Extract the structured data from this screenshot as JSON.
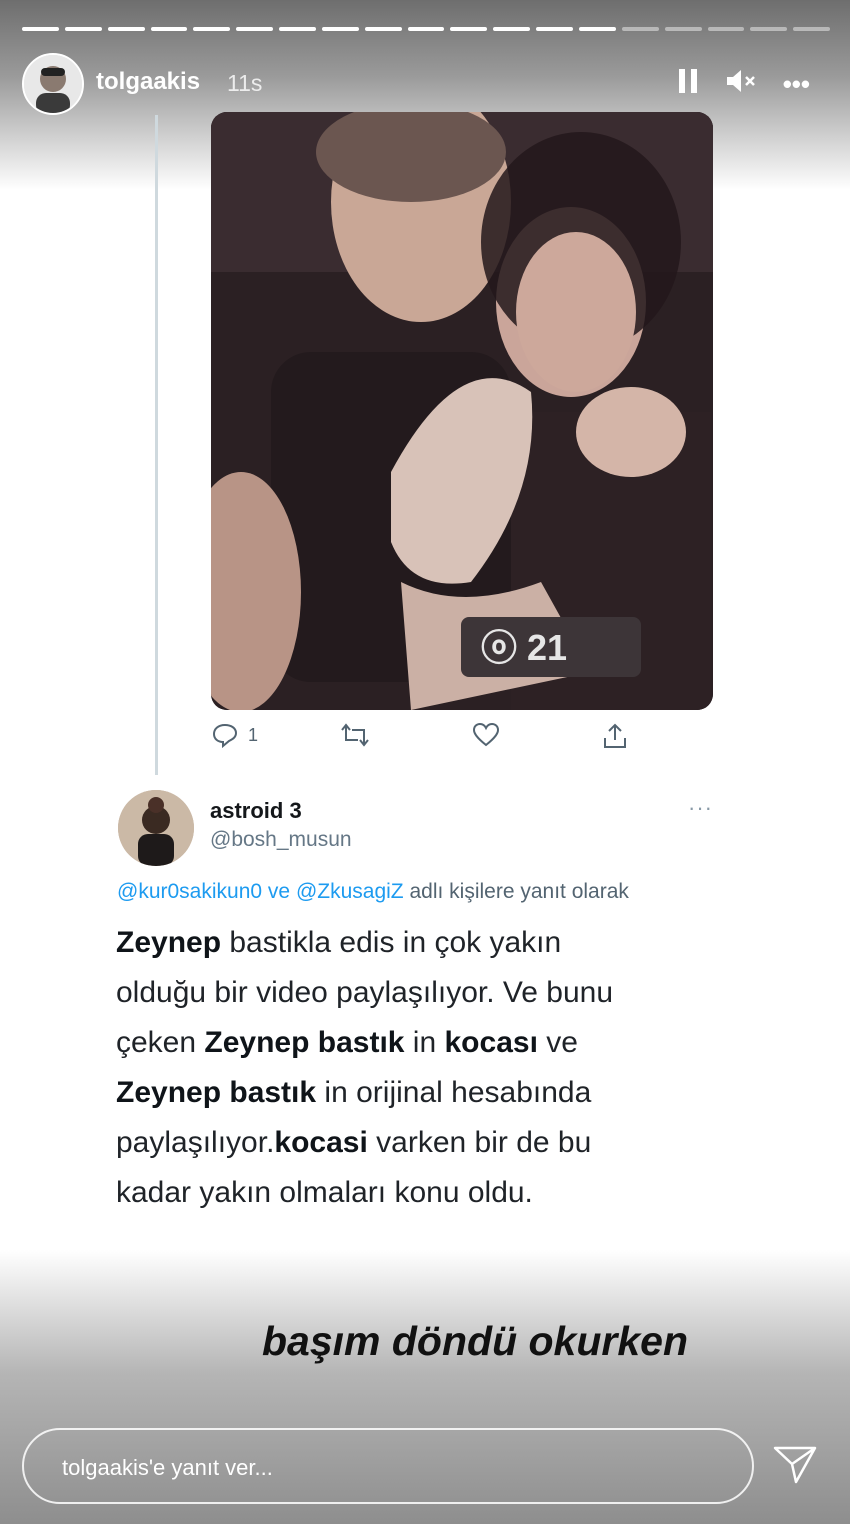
{
  "story": {
    "username": "tolgaakis",
    "time": "11s",
    "progress": {
      "segments": 19,
      "completed": 14
    }
  },
  "header_icons": {
    "pause": "pause-icon",
    "mute": "speaker-muted-icon",
    "more": "•••"
  },
  "tweet_actions": {
    "reply_count": "1"
  },
  "reply_tweet": {
    "name": "astroid 3",
    "handle": "@bosh_musun",
    "more": "···",
    "mention_1": "@kur0sakikun0",
    "mention_joiner": "ve",
    "mention_2": "@ZkusagiZ",
    "mention_suffix": "adlı kişilere yanıt olarak",
    "text": {
      "l1_b": "Zeynep",
      "l1_r": " bastikla edis in çok yakın",
      "l2": "olduğu bir video paylaşılıyor. Ve bunu",
      "l3_a": "çeken ",
      "l3_b1": "Zeynep bastık",
      "l3_m": " in ",
      "l3_b2": "kocası",
      "l3_e": " ve",
      "l4_b": "Zeynep bastık",
      "l4_r": " in orijinal hesabında",
      "l5_a": "paylaşılıyor.",
      "l5_b": "kocasi",
      "l5_r": " varken bir de bu",
      "l6": "kadar yakın olmaları konu oldu."
    }
  },
  "caption": "başım döndü okurken",
  "reply_input": {
    "placeholder": "tolgaakis'e yanıt ver..."
  }
}
